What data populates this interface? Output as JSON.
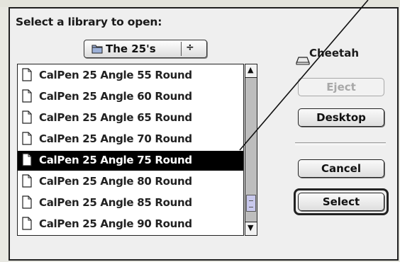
{
  "dialog": {
    "prompt": "Select a library to open:",
    "popup": {
      "selected": "The 25's",
      "arrows": "÷"
    },
    "volume": {
      "name": "Cheetah"
    },
    "files": [
      {
        "label": "CalPen 25 Angle 55 Round",
        "selected": false
      },
      {
        "label": "CalPen 25 Angle 60 Round",
        "selected": false
      },
      {
        "label": "CalPen 25 Angle 65 Round",
        "selected": false
      },
      {
        "label": "CalPen 25 Angle 70 Round",
        "selected": false
      },
      {
        "label": "CalPen 25 Angle 75 Round",
        "selected": true
      },
      {
        "label": "CalPen 25 Angle 80 Round",
        "selected": false
      },
      {
        "label": "CalPen 25 Angle 85 Round",
        "selected": false
      },
      {
        "label": "CalPen 25 Angle 90 Round",
        "selected": false
      }
    ],
    "buttons": {
      "eject": "Eject",
      "desktop": "Desktop",
      "cancel": "Cancel",
      "select": "Select"
    }
  },
  "icons": {
    "folder": "folder-icon",
    "document": "document-icon",
    "volume": "disk-icon",
    "scroll_up": "up-arrow-icon",
    "scroll_down": "down-arrow-icon"
  },
  "colors": {
    "selection_bg": "#000000",
    "selection_text": "#ffffff",
    "scroll_thumb": "#c8c8ec"
  }
}
